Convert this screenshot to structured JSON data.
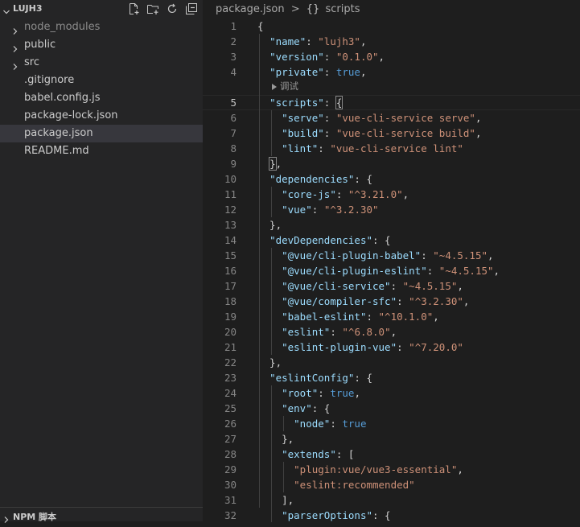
{
  "explorer": {
    "folder_name": "LUJH3",
    "items": [
      {
        "label": "node_modules",
        "type": "folder",
        "dim": true
      },
      {
        "label": "public",
        "type": "folder"
      },
      {
        "label": "src",
        "type": "folder"
      },
      {
        "label": ".gitignore",
        "type": "file"
      },
      {
        "label": "babel.config.js",
        "type": "file"
      },
      {
        "label": "package-lock.json",
        "type": "file"
      },
      {
        "label": "package.json",
        "type": "file",
        "selected": true
      },
      {
        "label": "README.md",
        "type": "file"
      }
    ],
    "header_icons": [
      "new-file-icon",
      "new-folder-icon",
      "refresh-icon",
      "collapse-all-icon"
    ],
    "npm_section": "NPM 脚本"
  },
  "editor": {
    "breadcrumb": {
      "file": "package.json",
      "separator": ">",
      "symbol_icon": "{}",
      "symbol": "scripts"
    },
    "codelens": "调试",
    "active_line": 5,
    "lines": [
      {
        "n": "1"
      },
      {
        "n": "2"
      },
      {
        "n": "3"
      },
      {
        "n": "4"
      },
      {
        "n": "5"
      },
      {
        "n": "6"
      },
      {
        "n": "7"
      },
      {
        "n": "8"
      },
      {
        "n": "9"
      },
      {
        "n": "10"
      },
      {
        "n": "11"
      },
      {
        "n": "12"
      },
      {
        "n": "13"
      },
      {
        "n": "14"
      },
      {
        "n": "15"
      },
      {
        "n": "16"
      },
      {
        "n": "17"
      },
      {
        "n": "18"
      },
      {
        "n": "19"
      },
      {
        "n": "20"
      },
      {
        "n": "21"
      },
      {
        "n": "22"
      },
      {
        "n": "23"
      },
      {
        "n": "24"
      },
      {
        "n": "25"
      },
      {
        "n": "26"
      },
      {
        "n": "27"
      },
      {
        "n": "28"
      },
      {
        "n": "29"
      },
      {
        "n": "30"
      },
      {
        "n": "31"
      },
      {
        "n": "32"
      }
    ],
    "code": {
      "l1": "{",
      "l2k": "\"name\"",
      "l2v": "\"lujh3\"",
      "l3k": "\"version\"",
      "l3v": "\"0.1.0\"",
      "l4k": "\"private\"",
      "l4v": "true",
      "l5k": "\"scripts\"",
      "l6k": "\"serve\"",
      "l6v": "\"vue-cli-service serve\"",
      "l7k": "\"build\"",
      "l7v": "\"vue-cli-service build\"",
      "l8k": "\"lint\"",
      "l8v": "\"vue-cli-service lint\"",
      "l10k": "\"dependencies\"",
      "l11k": "\"core-js\"",
      "l11v": "\"^3.21.0\"",
      "l12k": "\"vue\"",
      "l12v": "\"^3.2.30\"",
      "l14k": "\"devDependencies\"",
      "l15k": "\"@vue/cli-plugin-babel\"",
      "l15v": "\"~4.5.15\"",
      "l16k": "\"@vue/cli-plugin-eslint\"",
      "l16v": "\"~4.5.15\"",
      "l17k": "\"@vue/cli-service\"",
      "l17v": "\"~4.5.15\"",
      "l18k": "\"@vue/compiler-sfc\"",
      "l18v": "\"^3.2.30\"",
      "l19k": "\"babel-eslint\"",
      "l19v": "\"^10.1.0\"",
      "l20k": "\"eslint\"",
      "l20v": "\"^6.8.0\"",
      "l21k": "\"eslint-plugin-vue\"",
      "l21v": "\"^7.20.0\"",
      "l23k": "\"eslintConfig\"",
      "l24k": "\"root\"",
      "l24v": "true",
      "l25k": "\"env\"",
      "l26k": "\"node\"",
      "l26v": "true",
      "l28k": "\"extends\"",
      "l29v": "\"plugin:vue/vue3-essential\"",
      "l30v": "\"eslint:recommended\"",
      "l32k": "\"parserOptions\""
    }
  },
  "colors": {
    "background": "#1e1e1e",
    "sidebar": "#252526",
    "selected_item": "#37373d",
    "json_key": "#9cdcfe",
    "json_string": "#ce9178",
    "json_bool": "#569cd6"
  }
}
